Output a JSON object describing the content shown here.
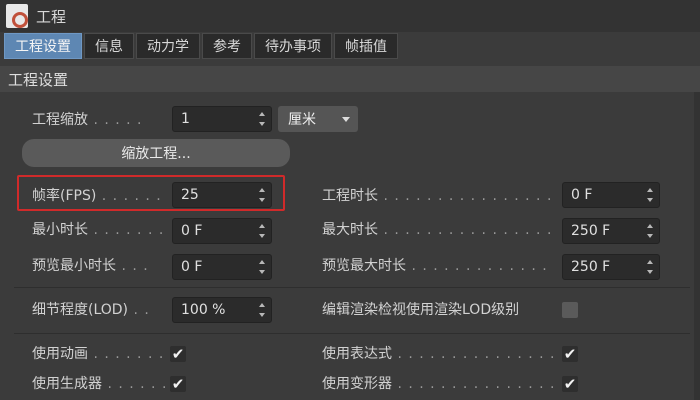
{
  "window": {
    "title": "工程"
  },
  "tabs": [
    {
      "label": "工程设置",
      "active": true
    },
    {
      "label": "信息",
      "active": false
    },
    {
      "label": "动力学",
      "active": false
    },
    {
      "label": "参考",
      "active": false
    },
    {
      "label": "待办事项",
      "active": false
    },
    {
      "label": "帧插值",
      "active": false
    }
  ],
  "section": {
    "title": "工程设置"
  },
  "scale": {
    "label": "工程缩放",
    "dots": " . . . . .",
    "value": "1",
    "unit": "厘米",
    "button": "缩放工程..."
  },
  "left": [
    {
      "label": "帧率(FPS)",
      "dots": " . . . . . .",
      "value": "25"
    },
    {
      "label": "最小时长",
      "dots": " . . . . . . .",
      "value": "0 F"
    },
    {
      "label": "预览最小时长",
      "dots": " . . .",
      "value": "0 F"
    }
  ],
  "right": [
    {
      "label": "工程时长",
      "dots": " . . . . . . . . . . . . . . . . . .",
      "value": "0 F"
    },
    {
      "label": "最大时长",
      "dots": " . . . . . . . . . . . . . . . . . .",
      "value": "250 F"
    },
    {
      "label": "预览最大时长",
      "dots": " . . . . . . . . . . . . .",
      "value": "250 F"
    }
  ],
  "lod": {
    "label": "细节程度(LOD)",
    "dots": " . .",
    "value": "100 %",
    "render_label": "编辑渲染检视使用渲染LOD级别"
  },
  "checks_left": [
    {
      "label": "使用动画",
      "dots": " . . . . . . . . .",
      "checked": true
    },
    {
      "label": "使用生成器",
      "dots": " . . . . . . .",
      "checked": true
    }
  ],
  "checks_right": [
    {
      "label": "使用表达式",
      "dots": " . . . . . . . . . . . . . . . . .",
      "checked": true
    },
    {
      "label": "使用变形器",
      "dots": " . . . . . . . . . . . . . . . . .",
      "checked": true
    }
  ],
  "glyphs": {
    "check": "✔"
  },
  "colors": {
    "active_tab": "#5e87b3",
    "highlight": "#d02a2a",
    "background": "#3b3b3b"
  }
}
